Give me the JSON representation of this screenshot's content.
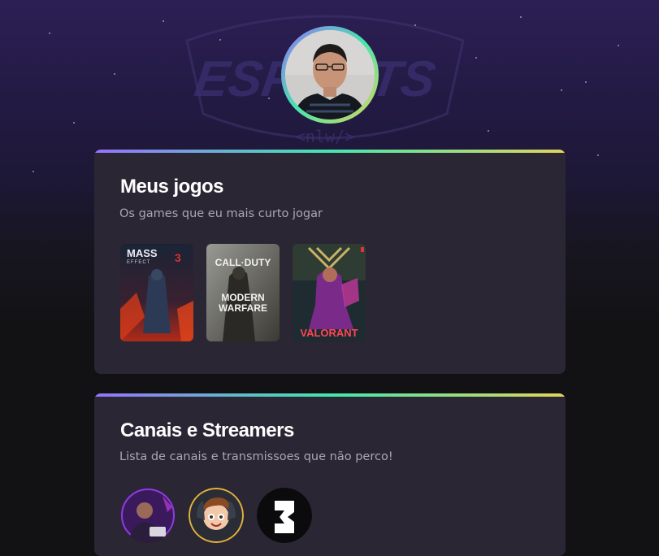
{
  "profile": {
    "avatar_icon": "profile-photo",
    "background_logo_text": "ESPORTS",
    "background_logo_sub": "<nlw/>"
  },
  "games_section": {
    "title": "Meus jogos",
    "subtitle": "Os games que eu mais curto jogar",
    "games": [
      {
        "name": "Mass Effect 3",
        "logo_line1": "MASS",
        "logo_line2": "EFFECT",
        "logo_num": "3"
      },
      {
        "name": "Call of Duty Modern Warfare",
        "logo_line1": "CALL·DUTY",
        "logo_line2": "MODERN",
        "logo_line3": "WARFARE"
      },
      {
        "name": "Valorant",
        "logo_line1": "VALORANT"
      }
    ]
  },
  "channels_section": {
    "title": "Canais e Streamers",
    "subtitle": "Lista de canais e transmissoes que não perco!",
    "channels": [
      {
        "name": "channel-1"
      },
      {
        "name": "channel-2"
      },
      {
        "name": "channel-3"
      }
    ]
  },
  "colors": {
    "gradient_start": "#9572fc",
    "gradient_mid": "#43e7ad",
    "gradient_end": "#e2d45c",
    "card_bg": "#2a2634",
    "page_bg": "#121214"
  }
}
